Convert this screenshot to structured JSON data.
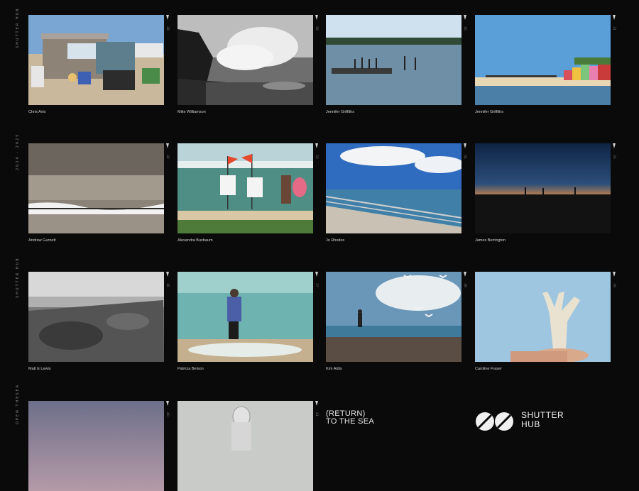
{
  "sidebar": {
    "top_label": "SHUTTER HUB",
    "mid_label": "2024 - 2025",
    "lower_label": "SHUTTER HUB",
    "bottom_label": "OPEN THESEA"
  },
  "photos": [
    {
      "caption": "Chris Avis",
      "num": "28"
    },
    {
      "caption": "Mike Williamson",
      "num": "29"
    },
    {
      "caption": "Jennifer Griffiths",
      "num": "30"
    },
    {
      "caption": "Jennifer Griffiths",
      "num": "31"
    },
    {
      "caption": "Andrew Gurnett",
      "num": "32"
    },
    {
      "caption": "Alexandra Buxbaum",
      "num": "33"
    },
    {
      "caption": "Jo Rhodes",
      "num": "34"
    },
    {
      "caption": "James Berrington",
      "num": "35"
    },
    {
      "caption": "Matt E Lewis",
      "num": "36"
    },
    {
      "caption": "Patricia Belson",
      "num": "37"
    },
    {
      "caption": "Kim Aldis",
      "num": "38"
    },
    {
      "caption": "Caroline Fraser",
      "num": "39"
    },
    {
      "caption": "",
      "num": "40"
    },
    {
      "caption": "",
      "num": "41"
    }
  ],
  "title": {
    "line1": "(RETURN)",
    "line2": "TO THE SEA"
  },
  "logo": {
    "line1": "SHUTTER",
    "line2": "HUB"
  },
  "colors": {
    "background": "#0b0a0a",
    "caption": "#d2d2d2"
  }
}
